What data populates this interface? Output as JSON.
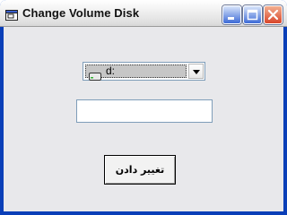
{
  "window": {
    "title": "Change Volume Disk",
    "icon": "app-window-icon",
    "controls": [
      "minimize-icon",
      "maximize-icon",
      "close-icon"
    ]
  },
  "drive_combo": {
    "selected": "d:",
    "icon": "drive-icon"
  },
  "volume_input": {
    "value": "",
    "placeholder": ""
  },
  "change_button": {
    "label": "تغيير دادن"
  },
  "colors": {
    "client_bg": "#e8e8eb",
    "close_button": "#d8452a",
    "window_frame": "#0a3fb8"
  }
}
